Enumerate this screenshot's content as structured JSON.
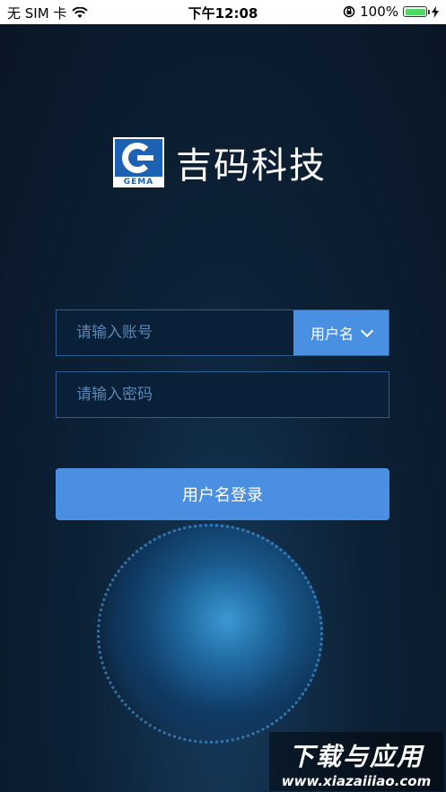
{
  "status_bar": {
    "carrier": "无 SIM 卡",
    "time": "下午12:08",
    "battery_percent": "100%",
    "battery_level": 1.0,
    "battery_color": "#4cd964"
  },
  "brand": {
    "logo_text": "GEMA",
    "name": "吉码科技"
  },
  "form": {
    "account_placeholder": "请输入账号",
    "account_type_label": "用户名",
    "password_placeholder": "请输入密码",
    "login_label": "用户名登录"
  },
  "watermark": {
    "title": "下载与应用",
    "url": "www.xiazaiiiao.com"
  },
  "colors": {
    "background": "#0b1b2c",
    "accent": "#4a90e2"
  }
}
